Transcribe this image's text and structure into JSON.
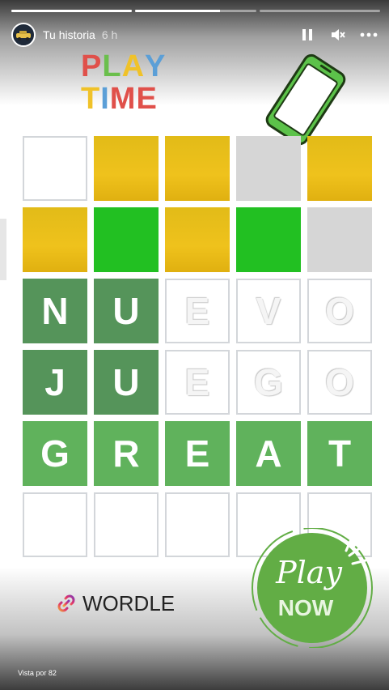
{
  "story": {
    "username": "Tu historia",
    "time_ago": "6 h",
    "viewers": "Vista por 82",
    "progress": [
      1.0,
      0.7,
      0.0
    ]
  },
  "controls": {
    "pause_icon": "pause-icon",
    "mute_icon": "mute-icon",
    "more_icon": "more-options-icon"
  },
  "sticker_title": {
    "line1": [
      "P",
      "L",
      "A",
      "Y"
    ],
    "line2": [
      "T",
      "I",
      "M",
      "E"
    ],
    "colors1": [
      "#e0504a",
      "#6bbf4c",
      "#f0c229",
      "#5b9fd7"
    ],
    "colors2": [
      "#f0c229",
      "#5b9fd7",
      "#e0504a",
      "#e0504a"
    ]
  },
  "grid": {
    "rows": [
      [
        {
          "l": "",
          "s": "empty"
        },
        {
          "l": "",
          "s": "yellow"
        },
        {
          "l": "",
          "s": "yellow"
        },
        {
          "l": "",
          "s": "gray"
        },
        {
          "l": "",
          "s": "yellow"
        }
      ],
      [
        {
          "l": "",
          "s": "yellow"
        },
        {
          "l": "",
          "s": "green"
        },
        {
          "l": "",
          "s": "yellow"
        },
        {
          "l": "",
          "s": "green"
        },
        {
          "l": "",
          "s": "gray"
        }
      ],
      [
        {
          "l": "N",
          "s": "dkgreen"
        },
        {
          "l": "U",
          "s": "dkgreen"
        },
        {
          "l": "E",
          "s": "ghost"
        },
        {
          "l": "V",
          "s": "ghost"
        },
        {
          "l": "O",
          "s": "ghost"
        }
      ],
      [
        {
          "l": "J",
          "s": "dkgreen"
        },
        {
          "l": "U",
          "s": "dkgreen"
        },
        {
          "l": "E",
          "s": "ghost"
        },
        {
          "l": "G",
          "s": "ghost"
        },
        {
          "l": "O",
          "s": "ghost"
        }
      ],
      [
        {
          "l": "G",
          "s": "lgreen"
        },
        {
          "l": "R",
          "s": "lgreen"
        },
        {
          "l": "E",
          "s": "lgreen"
        },
        {
          "l": "A",
          "s": "lgreen"
        },
        {
          "l": "T",
          "s": "lgreen"
        }
      ],
      [
        {
          "l": "",
          "s": "empty"
        },
        {
          "l": "",
          "s": "empty"
        },
        {
          "l": "",
          "s": "empty"
        },
        {
          "l": "",
          "s": "empty"
        },
        {
          "l": "",
          "s": "empty"
        }
      ]
    ]
  },
  "link_sticker": {
    "label": "WORDLE",
    "icon": "link-icon"
  },
  "play_now_badge": {
    "line1": "Play",
    "line2": "NOW"
  },
  "colors": {
    "green": "#22c022",
    "dark_green": "#55945a",
    "yellow": "#efc21c",
    "badge_green": "#62ad45"
  }
}
